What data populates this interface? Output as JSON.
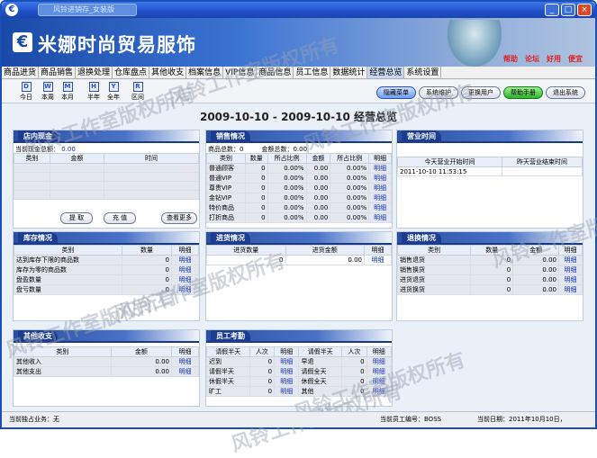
{
  "window": {
    "title": "风铃进销存_女装版"
  },
  "banner": {
    "app_name": "米娜时尚贸易服饰",
    "links": [
      "帮助",
      "论坛",
      "好用",
      "便宜"
    ]
  },
  "menu": [
    "商品进货",
    "商品销售",
    "退换处理",
    "仓库盘点",
    "其他收支",
    "档案信息",
    "VIP信息",
    "商品信息",
    "员工信息",
    "数据统计",
    "经营总览",
    "系统设置"
  ],
  "toolbar": {
    "tools": [
      "今日",
      "本周",
      "本月",
      "半年",
      "全年",
      "区间"
    ],
    "buttons": [
      "隐藏菜单",
      "系统维护",
      "更换用户",
      "帮助手册",
      "退出系统"
    ]
  },
  "headline": "2009-10-10 - 2009-10-10 经营总览",
  "store_cash": {
    "title": "店内现金",
    "total_label": "当前现金总额：",
    "total_value": "0.00",
    "columns": [
      "类别",
      "金额",
      "时间"
    ],
    "buttons": [
      "提 取",
      "充 值",
      "查看更多"
    ]
  },
  "sales": {
    "title": "销售情况",
    "goods_total": "商品总数：0",
    "amount_total": "金额总数：0.00",
    "columns": [
      "类别",
      "数量",
      "所占比例",
      "金额",
      "所占比例",
      "明细"
    ],
    "rows": [
      [
        "普通顾客",
        "0",
        "0.00%",
        "0.00",
        "0.00%",
        "明细"
      ],
      [
        "普通VIP",
        "0",
        "0.00%",
        "0.00",
        "0.00%",
        "明细"
      ],
      [
        "尊贵VIP",
        "0",
        "0.00%",
        "0.00",
        "0.00%",
        "明细"
      ],
      [
        "金钻VIP",
        "0",
        "0.00%",
        "0.00",
        "0.00%",
        "明细"
      ],
      [
        "特价商品",
        "0",
        "0.00%",
        "0.00",
        "0.00%",
        "明细"
      ],
      [
        "打折商品",
        "0",
        "0.00%",
        "0.00",
        "0.00%",
        "明细"
      ]
    ]
  },
  "business_time": {
    "title": "营业时间",
    "columns": [
      "今天营业开始时间",
      "昨天营业结束时间"
    ],
    "row": [
      "2011-10-10 11:53:15",
      ""
    ]
  },
  "inventory": {
    "title": "库存情况",
    "columns": [
      "类别",
      "数量",
      "明细"
    ],
    "rows": [
      [
        "达到库存下限的商品数",
        "0",
        "明细"
      ],
      [
        "库存为零的商品数",
        "0",
        "明细"
      ],
      [
        "盘盈数量",
        "0",
        "明细"
      ],
      [
        "盘亏数量",
        "0",
        "明细"
      ]
    ]
  },
  "purchase": {
    "title": "进货情况",
    "columns": [
      "进货数量",
      "进货金额",
      "明细"
    ],
    "row": [
      "0",
      "0.00",
      "明细"
    ]
  },
  "returns": {
    "title": "退换情况",
    "columns": [
      "类别",
      "数量",
      "金额",
      "明细"
    ],
    "rows": [
      [
        "销售退货",
        "0",
        "0.00",
        "明细"
      ],
      [
        "销售换货",
        "0",
        "0.00",
        "明细"
      ],
      [
        "进货退货",
        "0",
        "0.00",
        "明细"
      ],
      [
        "进货换货",
        "0",
        "0.00",
        "明细"
      ]
    ]
  },
  "other": {
    "title": "其他收支",
    "columns": [
      "类别",
      "金额",
      "明细"
    ],
    "rows": [
      [
        "其他收入",
        "0.00",
        "明细"
      ],
      [
        "其他支出",
        "0.00",
        "明细"
      ]
    ]
  },
  "attendance": {
    "title": "员工考勤",
    "columns": [
      "请假半天",
      "人次",
      "明细",
      "请假半天",
      "人次",
      "明细"
    ],
    "rows": [
      [
        "迟到",
        "0",
        "明细",
        "早退",
        "0",
        "明细"
      ],
      [
        "请假半天",
        "0",
        "明细",
        "请假全天",
        "0",
        "明细"
      ],
      [
        "休假半天",
        "0",
        "明细",
        "休假全天",
        "0",
        "明细"
      ],
      [
        "旷工",
        "0",
        "明细",
        "其他",
        "0",
        "明细"
      ]
    ]
  },
  "status": {
    "business": "当前独占业务：无",
    "employee": "当前员工编号：BOSS",
    "date": "当前日期：2011年10月10日，"
  },
  "watermark": "风铃工作室版权所有"
}
